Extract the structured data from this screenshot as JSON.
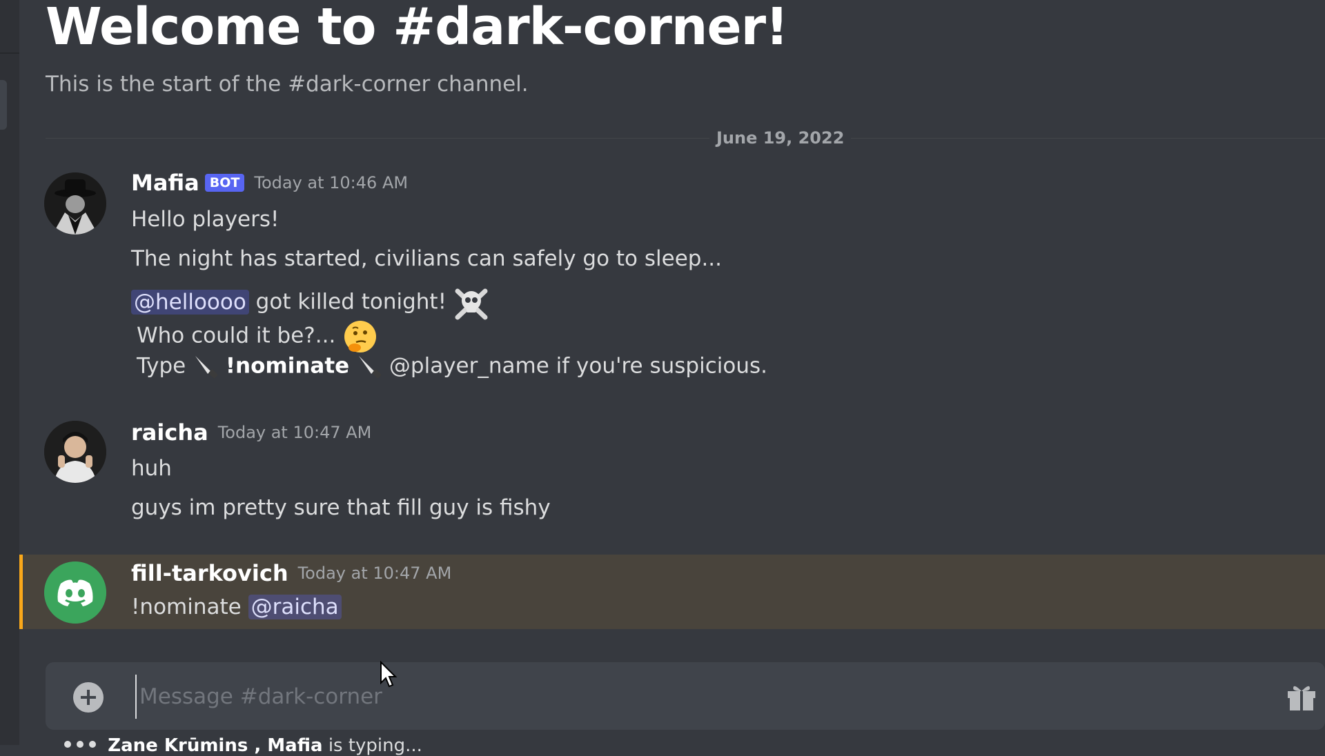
{
  "channel": {
    "welcome_title": "Welcome to #dark-corner!",
    "welcome_subtitle": "This is the start of the #dark-corner channel."
  },
  "date_divider": "June 19, 2022",
  "messages": [
    {
      "username": "Mafia",
      "bot_tag": "BOT",
      "timestamp": "Today at 10:46 AM",
      "avatar": "mafia-fedora-avatar",
      "lines": {
        "l1": "Hello players!",
        "l2": "The night has started, civilians can safely go to sleep...",
        "l3_mention": "@helloooo",
        "l3_text": "got killed tonight!",
        "l3_emoji": "skull-crossbones-icon",
        "l4_text": "Who could it be?...",
        "l4_emoji": "thinking-face-icon",
        "l5_type": "Type",
        "l5_command": "!nominate",
        "l5_rest": "@player_name if you're suspicious.",
        "l5_emoji": "knife-icon"
      }
    },
    {
      "username": "raicha",
      "timestamp": "Today at 10:47 AM",
      "avatar": "raicha-photo-avatar",
      "lines": {
        "l1": "huh",
        "l2": "guys im pretty sure that fill guy is fishy"
      }
    },
    {
      "username": "fill-tarkovich",
      "timestamp": "Today at 10:47 AM",
      "avatar": "discord-logo-avatar",
      "avatar_color": "#3ba55c",
      "lines": {
        "l1_text": "!nominate",
        "l1_mention": "@raicha"
      },
      "highlighted": true
    }
  ],
  "composer": {
    "placeholder": "Message #dark-corner",
    "add_icon": "plus-circle-icon",
    "gift_icon": "gift-icon"
  },
  "typing_indicator": {
    "names": "Zane Krūmins , Mafia",
    "suffix": "is typing..."
  },
  "colors": {
    "background": "#36393f",
    "bot_tag": "#5865f2",
    "mention_bg": "#414675",
    "highlight_border": "#faa81a",
    "highlight_bg": "#49443c"
  }
}
